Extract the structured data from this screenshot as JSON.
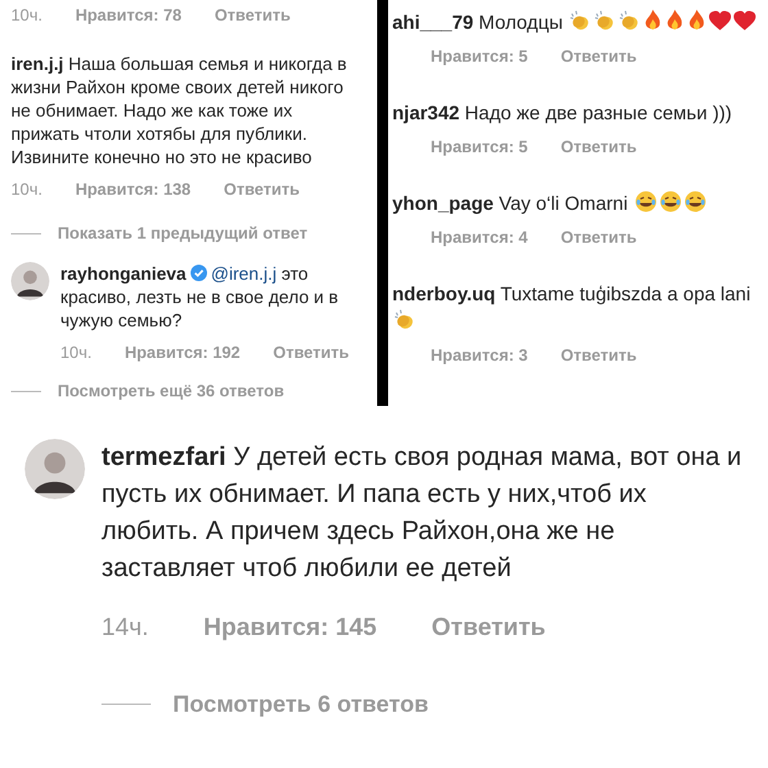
{
  "left_panel": {
    "top_meta": {
      "time": "10ч.",
      "likes": "Нравится: 78",
      "reply": "Ответить"
    },
    "comment": {
      "text": "**iren.j.j** Наша большая семья и никогда в жизни Райхон кроме своих детей никого не обнимает. Надо же как тоже их прижать чтоли хотябы для публики. Извините конечно но это не красиво",
      "time": "10ч.",
      "likes": "Нравится: 138",
      "reply": "Ответить"
    },
    "show_previous": "Показать 1 предыдущий ответ",
    "reply_comment": {
      "username": "rayhonganieva",
      "verified": true,
      "mention": "@iren.j.j",
      "text": "это красиво, лезть не в свое дело и в чужую семью?",
      "time": "10ч.",
      "likes": "Нравится: 192",
      "reply": "Ответить"
    },
    "view_more": "Посмотреть ещё 36 ответов"
  },
  "right_panel": {
    "comments": [
      {
        "text": "**ahi___79** Молодцы",
        "emoji": [
          {
            "kind": "clap"
          },
          {
            "kind": "clap"
          },
          {
            "kind": "clap"
          },
          {
            "kind": "fire"
          },
          {
            "kind": "fire"
          },
          {
            "kind": "fire"
          },
          {
            "kind": "heart"
          },
          {
            "kind": "heart"
          }
        ],
        "likes": "Нравится: 5",
        "reply": "Ответить"
      },
      {
        "text": "**njar342** Надо же две разные семьи )))",
        "likes": "Нравится: 5",
        "reply": "Ответить"
      },
      {
        "text": "**yhon_page** Vay o‘li Omarni",
        "emoji": [
          {
            "kind": "laugh"
          },
          {
            "kind": "laugh"
          },
          {
            "kind": "laugh"
          }
        ],
        "likes": "Нравится: 4",
        "reply": "Ответить"
      },
      {
        "text": "**nderboy.uq** Tuxtame tuģibszda a opa lani",
        "emoji": [
          {
            "kind": "clap"
          }
        ],
        "likes": "Нравится: 3",
        "reply": "Ответить"
      }
    ]
  },
  "bottom_comment": {
    "text": "**termezfari** У детей есть своя родная мама, вот она и пусть их обнимает. И папа есть у них,чтоб их любить. А причем здесь Райхон,она же не заставляет чтоб любили ее  детей",
    "time": "14ч.",
    "likes": "Нравится: 145",
    "reply": "Ответить",
    "view_replies": "Посмотреть 6 ответов"
  }
}
